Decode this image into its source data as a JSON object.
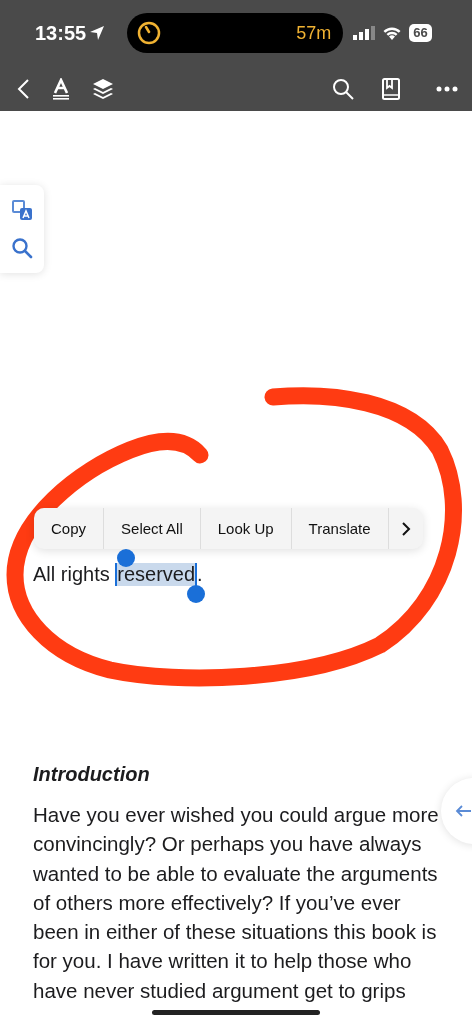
{
  "status_bar": {
    "time": "13:55",
    "activity_timer": "57m",
    "battery": "66"
  },
  "context_menu": {
    "items": [
      {
        "label": "Copy"
      },
      {
        "label": "Select All"
      },
      {
        "label": "Look Up"
      },
      {
        "label": "Translate"
      }
    ]
  },
  "selection_line": {
    "before": "All rights ",
    "selected": "reserved",
    "after": "."
  },
  "section": {
    "heading": "Introduction",
    "paragraph": "Have you ever wished you could argue more convincingly? Or perhaps you have always wanted to be able to evaluate the arguments of others more effectively? If you’ve ever been in either of these situations this book is for you. I have written it to help those who have never studied argument get to grips"
  }
}
